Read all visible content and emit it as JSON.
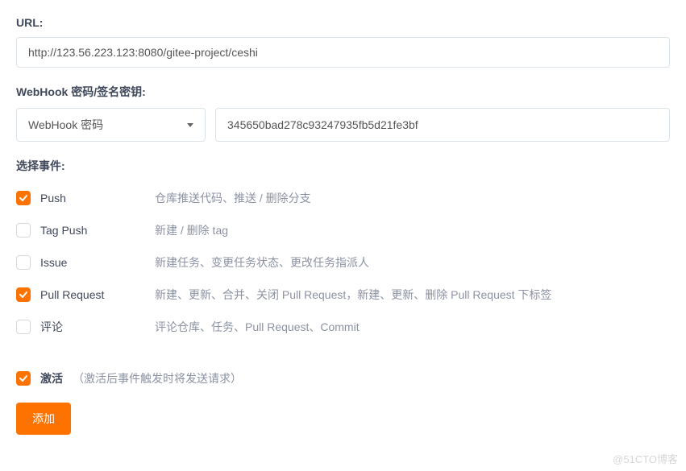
{
  "url": {
    "label": "URL:",
    "value": "http://123.56.223.123:8080/gitee-project/ceshi"
  },
  "secret": {
    "label": "WebHook 密码/签名密钥:",
    "type_selected": "WebHook 密码",
    "value": "345650bad278c93247935fb5d21fe3bf"
  },
  "events": {
    "label": "选择事件:",
    "items": [
      {
        "name": "Push",
        "desc": "仓库推送代码、推送 / 删除分支",
        "checked": true
      },
      {
        "name": "Tag Push",
        "desc": "新建 / 删除 tag",
        "checked": false
      },
      {
        "name": "Issue",
        "desc": "新建任务、变更任务状态、更改任务指派人",
        "checked": false
      },
      {
        "name": "Pull Request",
        "desc": "新建、更新、合并、关闭 Pull Request，新建、更新、删除 Pull Request 下标签",
        "checked": true
      },
      {
        "name": "评论",
        "desc": "评论仓库、任务、Pull Request、Commit",
        "checked": false
      }
    ]
  },
  "activate": {
    "label": "激活",
    "hint": "（激活后事件触发时将发送请求）",
    "checked": true
  },
  "submit": {
    "label": "添加"
  },
  "watermark": "@51CTO博客"
}
